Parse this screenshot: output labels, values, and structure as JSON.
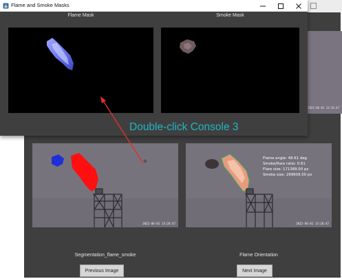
{
  "front_window": {
    "title": "Flame and Smoke Masks",
    "controls": {
      "minimize": "—",
      "maximize": "☐",
      "close": "✕"
    },
    "flame_mask_label": "Flame Mask",
    "smoke_mask_label": "Smoke Mask"
  },
  "back_window": {
    "segmentation_caption": "Segmentation_flame_smoke",
    "orientation_caption": "Flame Orientation",
    "previous_button": "Previous Image",
    "next_button": "Next Image",
    "timestamp": "2022-06-01 13:26:47",
    "orientation_overlay": [
      "Flame angle: 48.61 deg",
      "Smoke/flare ratio: 0.61",
      "Flare size: 171389.00 px",
      "Smoke size: 269609.00 px"
    ]
  },
  "annotation": {
    "text": "Double-click Console 3",
    "color": "#20b6c2",
    "arrow_color": "#e03030"
  },
  "colors": {
    "window_bg": "#3f3f3f",
    "mask_bg": "#000000",
    "smoke_segment": "#1f2fd8",
    "flame_segment": "#ff1010"
  }
}
